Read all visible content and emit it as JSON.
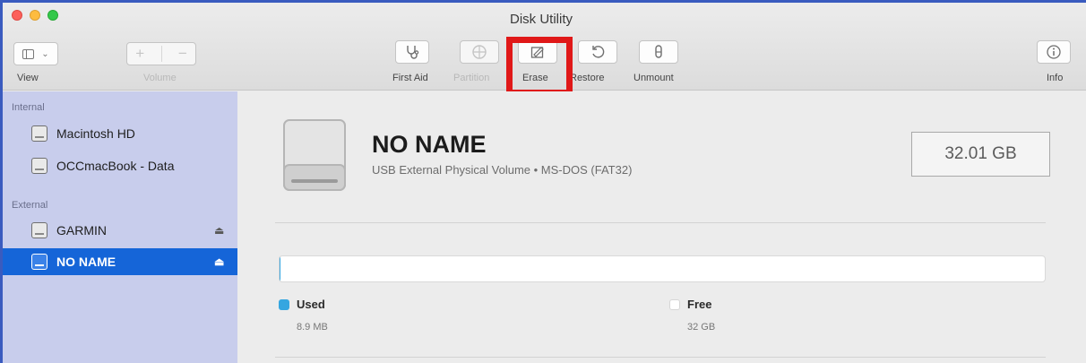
{
  "window": {
    "title": "Disk Utility"
  },
  "toolbar": {
    "view_label": "View",
    "volume_label": "Volume",
    "first_aid_label": "First Aid",
    "partition_label": "Partition",
    "erase_label": "Erase",
    "restore_label": "Restore",
    "unmount_label": "Unmount",
    "info_label": "Info"
  },
  "sidebar": {
    "internal_heading": "Internal",
    "external_heading": "External",
    "internal_items": [
      {
        "label": "Macintosh HD"
      },
      {
        "label": "OCCmacBook - Data"
      }
    ],
    "external_items": [
      {
        "label": "GARMIN"
      },
      {
        "label": "NO NAME"
      }
    ]
  },
  "volume": {
    "name": "NO NAME",
    "description": "USB External Physical Volume • MS-DOS (FAT32)",
    "capacity": "32.01 GB"
  },
  "usage": {
    "used_label": "Used",
    "used_value": "8.9 MB",
    "free_label": "Free",
    "free_value": "32 GB",
    "used_fraction": 0.0003
  },
  "colors": {
    "used": "#35a6e0",
    "free": "#ffffff",
    "selection": "#1565d8",
    "highlight": "#e01818"
  }
}
